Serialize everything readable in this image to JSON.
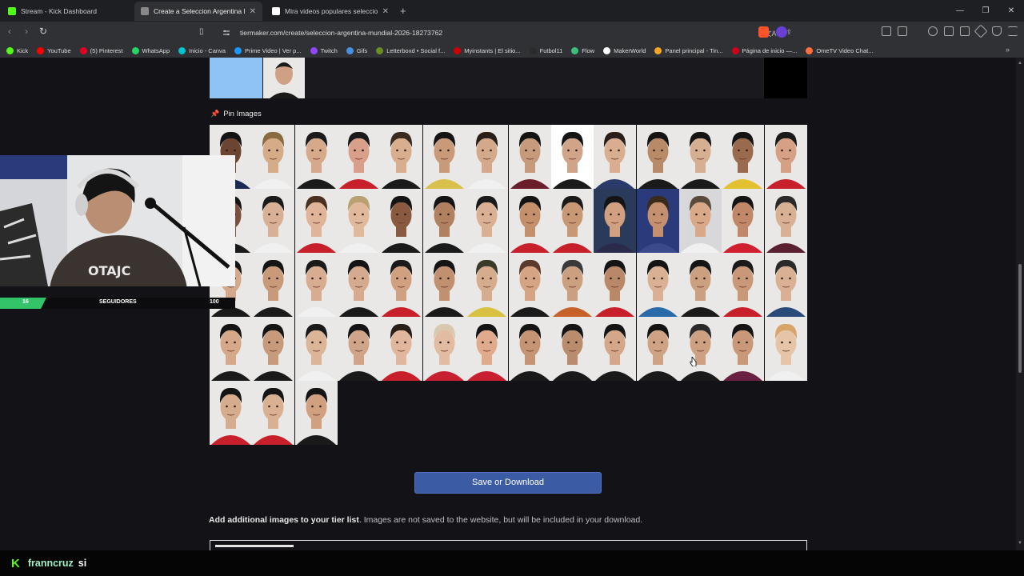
{
  "browser": {
    "tabs": [
      {
        "title": "Stream - Kick Dashboard",
        "active": false,
        "favicon_color": "#53fc18"
      },
      {
        "title": "Create a Seleccion Argentina Mu",
        "active": true,
        "favicon_color": "#888888"
      },
      {
        "title": "Mira videos populares seleccionados",
        "active": false,
        "favicon_color": "#ffffff"
      }
    ],
    "new_tab": "+",
    "url": "tiermaker.com/create/seleccion-argentina-mundial-2026-18273762",
    "bookmarks": [
      {
        "label": "Kick",
        "color": "#53fc18"
      },
      {
        "label": "YouTube",
        "color": "#ff0000"
      },
      {
        "label": "(5) Pinterest",
        "color": "#e60023"
      },
      {
        "label": "WhatsApp",
        "color": "#25d366"
      },
      {
        "label": "Inicio - Canva",
        "color": "#00c4cc"
      },
      {
        "label": "Prime Video | Ver p...",
        "color": "#1a98ff"
      },
      {
        "label": "Twitch",
        "color": "#9146ff"
      },
      {
        "label": "Gifs",
        "color": "#4a90e2"
      },
      {
        "label": "Letterboxd • Social f...",
        "color": "#6b8e23"
      },
      {
        "label": "Myinstants | El sitio...",
        "color": "#d00000"
      },
      {
        "label": "Futbol11",
        "color": "#2a2a2a"
      },
      {
        "label": "Flow",
        "color": "#3cbf7a"
      },
      {
        "label": "MakerWorld",
        "color": "#ffffff"
      },
      {
        "label": "Panel principal - Tin...",
        "color": "#f5a623"
      },
      {
        "label": "Página de inicio —...",
        "color": "#d0021b"
      },
      {
        "label": "OmeTV Video Chat...",
        "color": "#ff6f3c"
      }
    ]
  },
  "page": {
    "pin_images_label": "Pin Images",
    "save_button": "Save or Download",
    "add_images_bold": "Add additional images to your tier list",
    "add_images_rest": ". Images are not saved to the website, but will be included in your download.",
    "grid": {
      "columns": 14,
      "rows": [
        14,
        14,
        14,
        14,
        3
      ],
      "players": [
        {
          "bg": "#e9e8e6",
          "jersey": "#1b2a52",
          "skin": "#6b4532",
          "hair": "#141414"
        },
        {
          "bg": "#e9e8e6",
          "jersey": "#f0f0f0",
          "skin": "#d5ab88",
          "hair": "#8a6a40"
        },
        {
          "bg": "#e9e8e6",
          "jersey": "#1a1a1a",
          "skin": "#d6a98a",
          "hair": "#1a1a1a"
        },
        {
          "bg": "#e9e8e6",
          "jersey": "#c8202a",
          "skin": "#d8a08a",
          "hair": "#1a1a1a"
        },
        {
          "bg": "#e9e8e6",
          "jersey": "#1a1a1a",
          "skin": "#d9ae8f",
          "hair": "#3a2b20"
        },
        {
          "bg": "#e9e8e6",
          "jersey": "#d8c04a",
          "skin": "#c99a7a",
          "hair": "#141414"
        },
        {
          "bg": "#e9e8e6",
          "jersey": "#f0f0f0",
          "skin": "#d4a88a",
          "hair": "#2a1e18"
        },
        {
          "bg": "#e9e8e6",
          "jersey": "#6a1e2a",
          "skin": "#c79a7c",
          "hair": "#141414"
        },
        {
          "bg": "#ffffff",
          "jersey": "#1a1a1a",
          "skin": "#d0a488",
          "hair": "#141414"
        },
        {
          "bg": "#e9e8e6",
          "jersey": "#2a3a6a",
          "skin": "#d8ad90",
          "hair": "#2a1e18"
        },
        {
          "bg": "#e9e8e6",
          "jersey": "#1a1a1a",
          "skin": "#b98a68",
          "hair": "#141414"
        },
        {
          "bg": "#e9e8e6",
          "jersey": "#1a1a1a",
          "skin": "#d6ae92",
          "hair": "#141414"
        },
        {
          "bg": "#e9e8e6",
          "jersey": "#e2c030",
          "skin": "#9a6a4e",
          "hair": "#141414"
        },
        {
          "bg": "#e9e8e6",
          "jersey": "#c8202a",
          "skin": "#d6a084",
          "hair": "#1a1a1a"
        },
        {
          "bg": "#e9e8e6",
          "jersey": "#1a1a1a",
          "skin": "#7a5040",
          "hair": "#141414"
        },
        {
          "bg": "#e9e8e6",
          "jersey": "#f0f0f0",
          "skin": "#d8b095",
          "hair": "#1a1a1a"
        },
        {
          "bg": "#e9e8e6",
          "jersey": "#c8202a",
          "skin": "#e0b498",
          "hair": "#4a3020"
        },
        {
          "bg": "#e9e8e6",
          "jersey": "#f0f0f0",
          "skin": "#e0b89c",
          "hair": "#b8a070"
        },
        {
          "bg": "#e9e8e6",
          "jersey": "#1a1a1a",
          "skin": "#8a5a40",
          "hair": "#141414"
        },
        {
          "bg": "#e9e8e6",
          "jersey": "#1a1a1a",
          "skin": "#b08060",
          "hair": "#141414"
        },
        {
          "bg": "#e9e8e6",
          "jersey": "#f0f0f0",
          "skin": "#dab094",
          "hair": "#1a1a1a"
        },
        {
          "bg": "#e9e8e6",
          "jersey": "#c8202a",
          "skin": "#c4906c",
          "hair": "#141414"
        },
        {
          "bg": "#e9e8e6",
          "jersey": "#c8202a",
          "skin": "#c89874",
          "hair": "#1a1a1a"
        },
        {
          "bg": "#2a3a5a",
          "jersey": "#2a2a4a",
          "skin": "#d0a080",
          "hair": "#141414"
        },
        {
          "bg": "#2a3a7a",
          "jersey": "#3a4a8a",
          "skin": "#c49070",
          "hair": "#3a2a1a"
        },
        {
          "bg": "#d8d8da",
          "jersey": "#f0f0f0",
          "skin": "#d8a888",
          "hair": "#5a4a3a"
        },
        {
          "bg": "#e9e8e6",
          "jersey": "#d02030",
          "skin": "#c08868",
          "hair": "#141414"
        },
        {
          "bg": "#e9e8e6",
          "jersey": "#5a2030",
          "skin": "#d8b094",
          "hair": "#2a2a2a"
        },
        {
          "bg": "#e9e8e6",
          "jersey": "#1a1a1a",
          "skin": "#d4a88a",
          "hair": "#141414"
        },
        {
          "bg": "#e9e8e6",
          "jersey": "#1a1a1a",
          "skin": "#c89a7a",
          "hair": "#141414"
        },
        {
          "bg": "#e9e8e6",
          "jersey": "#f0f0f0",
          "skin": "#d8ac90",
          "hair": "#1a1a1a"
        },
        {
          "bg": "#e9e8e6",
          "jersey": "#1a1a1a",
          "skin": "#d6aa8e",
          "hair": "#141414"
        },
        {
          "bg": "#e9e8e6",
          "jersey": "#c8202a",
          "skin": "#d0a080",
          "hair": "#1a1a1a"
        },
        {
          "bg": "#e9e8e6",
          "jersey": "#1a1a1a",
          "skin": "#c09070",
          "hair": "#141414"
        },
        {
          "bg": "#e9e8e6",
          "jersey": "#d8c040",
          "skin": "#d6ac8e",
          "hair": "#3a3a2a"
        },
        {
          "bg": "#e9e8e6",
          "jersey": "#1a1a1a",
          "skin": "#d4a484",
          "hair": "#5a3a2a"
        },
        {
          "bg": "#e9e8e6",
          "jersey": "#c8602a",
          "skin": "#caa080",
          "hair": "#3a3a3a"
        },
        {
          "bg": "#e9e8e6",
          "jersey": "#c8202a",
          "skin": "#b88868",
          "hair": "#141414"
        },
        {
          "bg": "#e9e8e6",
          "jersey": "#2a6aa8",
          "skin": "#dab094",
          "hair": "#141414"
        },
        {
          "bg": "#e9e8e6",
          "jersey": "#1a1a1a",
          "skin": "#caa080",
          "hair": "#141414"
        },
        {
          "bg": "#e9e8e6",
          "jersey": "#c8202a",
          "skin": "#c89878",
          "hair": "#1a1a1a"
        },
        {
          "bg": "#e9e8e6",
          "jersey": "#2a4a7a",
          "skin": "#dab094",
          "hair": "#2a2a2a"
        },
        {
          "bg": "#e9e8e6",
          "jersey": "#1a1a1a",
          "skin": "#d4a888",
          "hair": "#141414"
        },
        {
          "bg": "#e9e8e6",
          "jersey": "#1a1a1a",
          "skin": "#c89a7c",
          "hair": "#141414"
        },
        {
          "bg": "#e9e8e6",
          "jersey": "#f0f0f0",
          "skin": "#dcb498",
          "hair": "#1a1a1a"
        },
        {
          "bg": "#e9e8e6",
          "jersey": "#1a1a1a",
          "skin": "#d0a488",
          "hair": "#141414"
        },
        {
          "bg": "#e9e8e6",
          "jersey": "#c8202a",
          "skin": "#e0b69c",
          "hair": "#2a1e18"
        },
        {
          "bg": "#e9e8e6",
          "jersey": "#c82030",
          "skin": "#e2bca2",
          "hair": "#d8c8b0"
        },
        {
          "bg": "#e9e8e6",
          "jersey": "#c82030",
          "skin": "#e0aa8c",
          "hair": "#141414"
        },
        {
          "bg": "#e9e8e6",
          "jersey": "#1a1a1a",
          "skin": "#c49474",
          "hair": "#141414"
        },
        {
          "bg": "#e9e8e6",
          "jersey": "#1a1a1a",
          "skin": "#b88c6c",
          "hair": "#141414"
        },
        {
          "bg": "#e9e8e6",
          "jersey": "#1a1a1a",
          "skin": "#d4a68a",
          "hair": "#141414"
        },
        {
          "bg": "#e9e8e6",
          "jersey": "#1a1a1a",
          "skin": "#d0a284",
          "hair": "#141414"
        },
        {
          "bg": "#e9e8e6",
          "jersey": "#1a1a1a",
          "skin": "#cca080",
          "hair": "#2a2a2a"
        },
        {
          "bg": "#e9e8e6",
          "jersey": "#6a2040",
          "skin": "#c89878",
          "hair": "#141414"
        },
        {
          "bg": "#e9e8e6",
          "jersey": "#f0f0f0",
          "skin": "#e6c4a8",
          "hair": "#d8a468"
        },
        {
          "bg": "#e9e8e6",
          "jersey": "#c8202a",
          "skin": "#d6ac8e",
          "hair": "#141414"
        },
        {
          "bg": "#e9e8e6",
          "jersey": "#c8202a",
          "skin": "#dab092",
          "hair": "#141414"
        },
        {
          "bg": "#e9e8e6",
          "jersey": "#1a1a1a",
          "skin": "#d0a080",
          "hair": "#141414"
        }
      ]
    }
  },
  "stream_overlay": {
    "followers_current": "16",
    "followers_label": "SEGUIDORES",
    "followers_goal": "100"
  },
  "chat": {
    "username": "franncruz",
    "message": "si"
  }
}
